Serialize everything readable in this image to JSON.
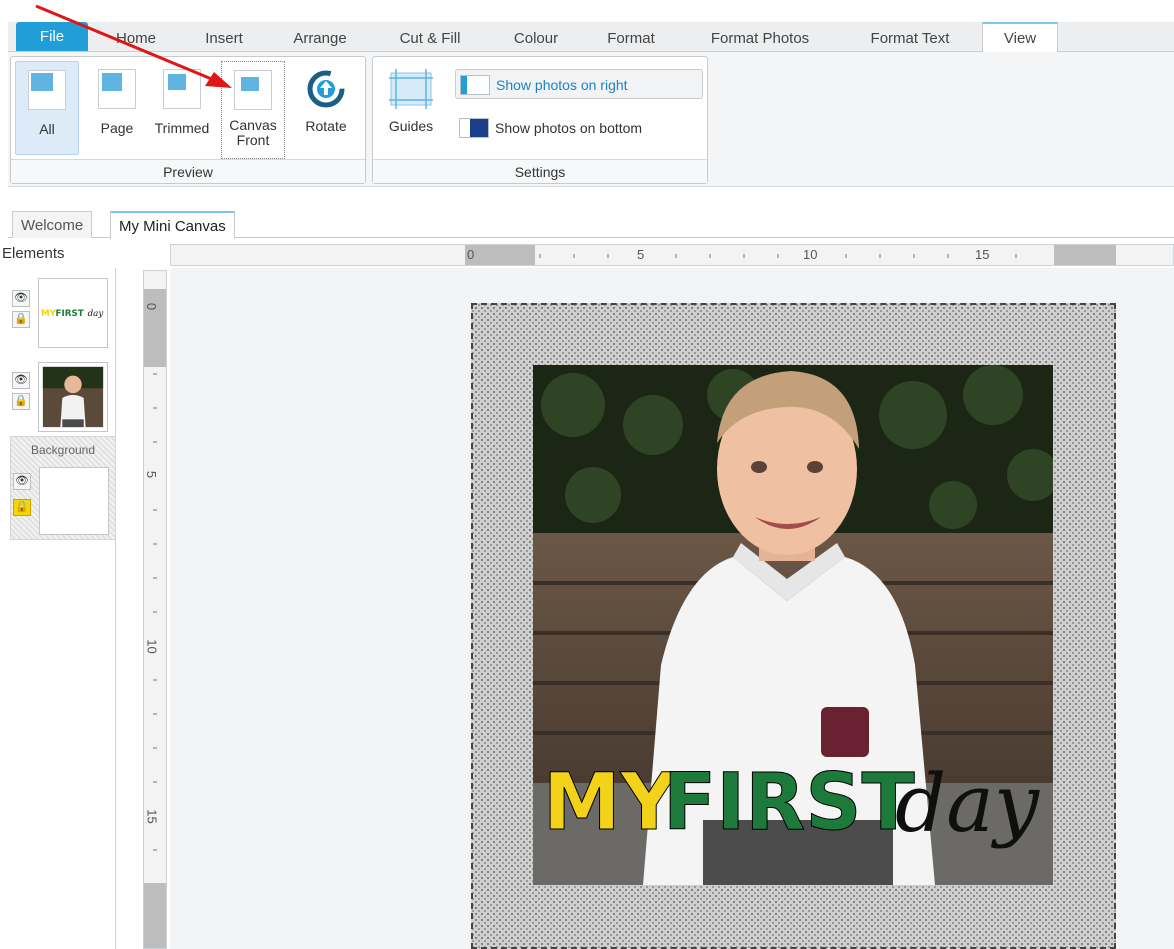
{
  "menu": {
    "tabs": [
      "File",
      "Home",
      "Insert",
      "Arrange",
      "Cut & Fill",
      "Colour",
      "Format",
      "Format Photos",
      "Format Text",
      "View"
    ]
  },
  "ribbon": {
    "preview": {
      "label": "Preview",
      "buttons": {
        "all": "All",
        "page": "Page",
        "trimmed": "Trimmed",
        "canvas_front_1": "Canvas",
        "canvas_front_2": "Front",
        "rotate": "Rotate"
      }
    },
    "settings": {
      "label": "Settings",
      "guides": "Guides",
      "show_right": "Show photos on right",
      "show_bottom": "Show photos on bottom"
    }
  },
  "doc_tabs": [
    "Welcome",
    "My Mini Canvas"
  ],
  "elements": {
    "title": "Elements",
    "background_label": "Background"
  },
  "rulers": {
    "horizontal": [
      "0",
      "5",
      "10",
      "15"
    ],
    "vertical": [
      "0",
      "5",
      "10",
      "15"
    ]
  },
  "canvas": {
    "text_my": "MY",
    "text_first": "FIRST",
    "text_day": "day"
  },
  "colors": {
    "accent": "#1f9ed8",
    "yellow": "#f3d21a",
    "green": "#1e7a3b"
  }
}
